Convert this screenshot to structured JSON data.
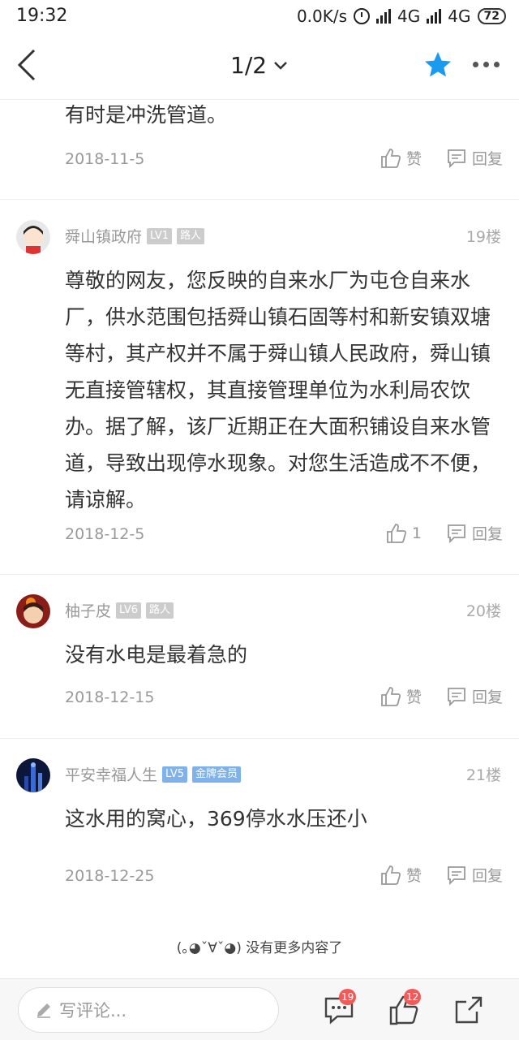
{
  "status_bar": {
    "time": "19:32",
    "net_speed": "0.0K/s",
    "network1": "4G",
    "network2": "4G",
    "battery": "72"
  },
  "nav": {
    "pager": "1/2"
  },
  "posts": [
    {
      "body": "有时是冲洗管道。",
      "date": "2018-11-5",
      "like": "赞",
      "reply": "回复"
    },
    {
      "user": "舜山镇政府",
      "level": "LV1",
      "tag": "路人",
      "floor": "19楼",
      "body": "尊敬的网友，您反映的自来水厂为屯仓自来水厂，供水范围包括舜山镇石固等村和新安镇双塘等村，其产权并不属于舜山镇人民政府，舜山镇无直接管辖权，其直接管理单位为水利局农饮办。据了解，该厂近期正在大面积铺设自来水管道，导致出现停水现象。对您生活造成不不便，请谅解。",
      "date": "2018-12-5",
      "like": "1",
      "reply": "回复"
    },
    {
      "user": "柚子皮",
      "level": "LV6",
      "tag": "路人",
      "floor": "20楼",
      "body": "没有水电是最着急的",
      "date": "2018-12-15",
      "like": "赞",
      "reply": "回复"
    },
    {
      "user": "平安幸福人生",
      "level": "LV5",
      "tag": "金牌会员",
      "floor": "21楼",
      "body": "这水用的窝心，369停水水压还小",
      "date": "2018-12-25",
      "like": "赞",
      "reply": "回复"
    }
  ],
  "footer_note": "(｡◕ˇ∀ˇ◕) 没有更多内容了",
  "bottom": {
    "comment_placeholder": "写评论...",
    "comment_count": "19",
    "like_count": "12"
  },
  "colors": {
    "accent": "#1a9bf0",
    "badge_red": "#f25a5a",
    "level_badge": "#cccccc",
    "vip_badge": "#7fb2ea"
  }
}
